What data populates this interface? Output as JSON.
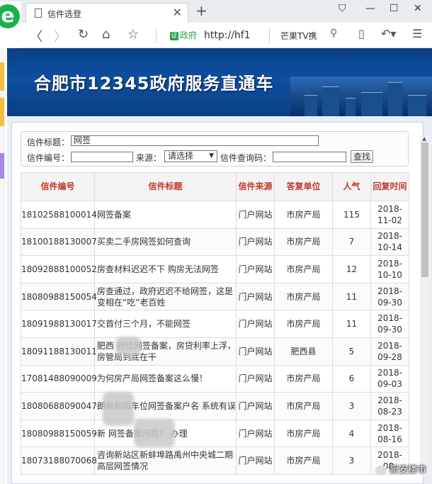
{
  "browser": {
    "tab_title": "信件选登",
    "gov_label": "政府",
    "url": "http://hf1",
    "search_text": "芒果TV携"
  },
  "banner": {
    "title": "合肥市12345政府服务直通车"
  },
  "search": {
    "title_label": "信件标题：",
    "title_value": "网签",
    "number_label": "信件编号：",
    "source_label": "来源：",
    "source_selected": "请选择",
    "query_label": "信件查询码：",
    "button": "查找"
  },
  "table": {
    "headers": [
      "信件编号",
      "信件标题",
      "信件来源",
      "答复单位",
      "人气",
      "回复时间"
    ],
    "rows": [
      [
        "18102588100014",
        "网签备案",
        "门户网站",
        "市房产局",
        "115",
        "2018-11-02"
      ],
      [
        "18100188130007",
        "买卖二手房网签如何查询",
        "门户网站",
        "市房产局",
        "7",
        "2018-10-14"
      ],
      [
        "18092888100052",
        "房查材料迟迟不下 购房无法网签",
        "门户网站",
        "市房产局",
        "12",
        "2018-10-10"
      ],
      [
        "18080988150054",
        "房查通过，政府迟迟不给网签，这是变相在“吃”老百姓",
        "门户网站",
        "市房产局",
        "11",
        "2018-09-30"
      ],
      [
        "18091988130017",
        "交首付三个月，不能网签",
        "门户网站",
        "市房产局",
        "11",
        "2018-09-30"
      ],
      [
        "18091188130011",
        "肥西 府给网签备案，房贷利率上浮，房管局到底在干",
        "门户网站",
        "肥西县",
        "5",
        "2018-09-28"
      ],
      [
        "17081488090009",
        "为何房产局网签备案这么慢！",
        "门户网站",
        "市房产局",
        "6",
        "2018-09-03"
      ],
      [
        "18080688090047",
        "朗融和园车位网签备案户名 系统有误",
        "门户网站",
        "市房产局",
        "3",
        "2018-08-23"
      ],
      [
        "18080988150059",
        "新 网签备案问题！ 办理",
        "门户网站",
        "市房产局",
        "4",
        "2018-08-16"
      ],
      [
        "18073188070068",
        "咨询新站区新蚌埠路禹州中央城二期高层网签情况",
        "门户网站",
        "市房产局",
        "3",
        "2018-08-"
      ]
    ]
  },
  "watermark": "新安楼市"
}
